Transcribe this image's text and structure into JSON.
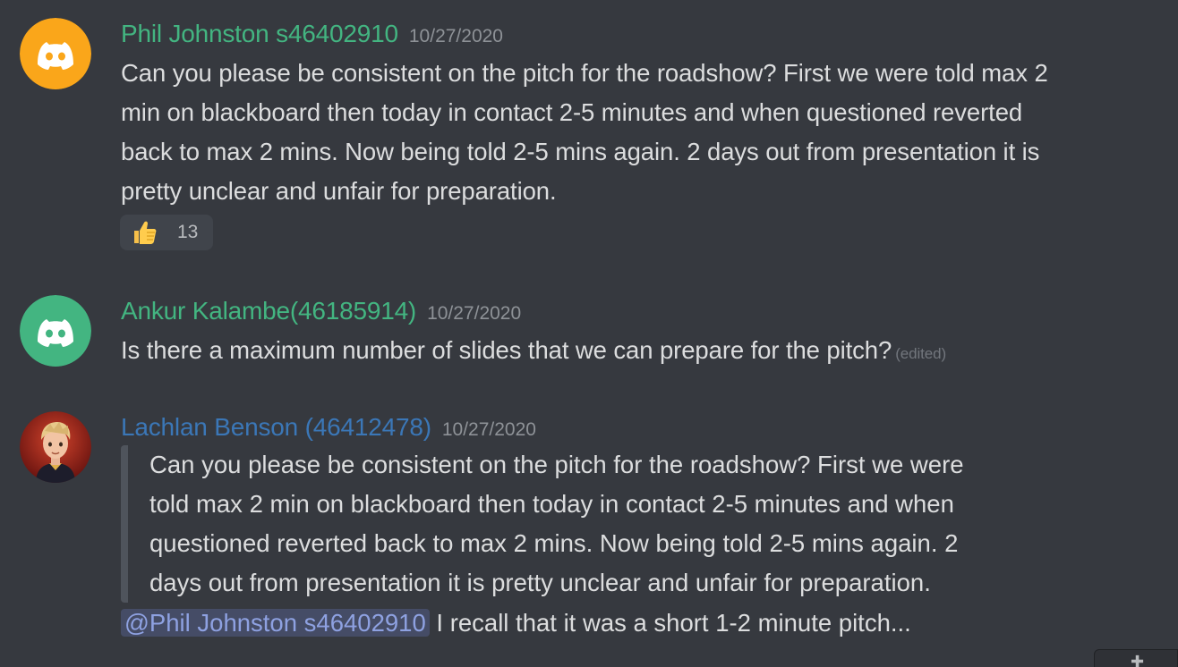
{
  "colors": {
    "background": "#36393f",
    "phil_name": "#43b581",
    "ankur_name": "#43b581",
    "lachlan_name": "#3b77b7",
    "avatar_orange": "#faa61a",
    "avatar_green": "#43b581",
    "mention_text": "#8ea1e1"
  },
  "messages": [
    {
      "author": "Phil Johnston s46402910",
      "timestamp": "10/27/2020",
      "avatar_icon": "discord-logo-icon",
      "lines": [
        "Can you please be consistent on the pitch for the roadshow? First we were told max 2",
        "min on blackboard then today in contact 2-5 minutes and when questioned reverted",
        "back to max 2 mins. Now being told 2-5 mins again. 2 days out from presentation it is",
        "pretty unclear and unfair for preparation."
      ],
      "reaction": {
        "emoji_icon": "thumbs-up-icon",
        "count": "13"
      }
    },
    {
      "author": "Ankur Kalambe(46185914)",
      "timestamp": "10/27/2020",
      "avatar_icon": "discord-logo-icon",
      "text": "Is there a maximum number of slides that we can prepare for the pitch?",
      "edited_label": "(edited)"
    },
    {
      "author": "Lachlan Benson (46412478)",
      "timestamp": "10/27/2020",
      "avatar_icon": "cartoon-avatar-icon",
      "quote_lines": [
        "Can you please be consistent on the pitch for the roadshow? First we were",
        "told max 2 min on blackboard then today in contact 2-5 minutes and when",
        "questioned reverted back to max 2 mins. Now being told 2-5 mins again. 2",
        "days out from presentation it is pretty unclear and unfair for preparation."
      ],
      "mention": "@Phil Johnston s46402910",
      "reply_text": " I recall that it was a short 1-2 minute pitch..."
    }
  ]
}
